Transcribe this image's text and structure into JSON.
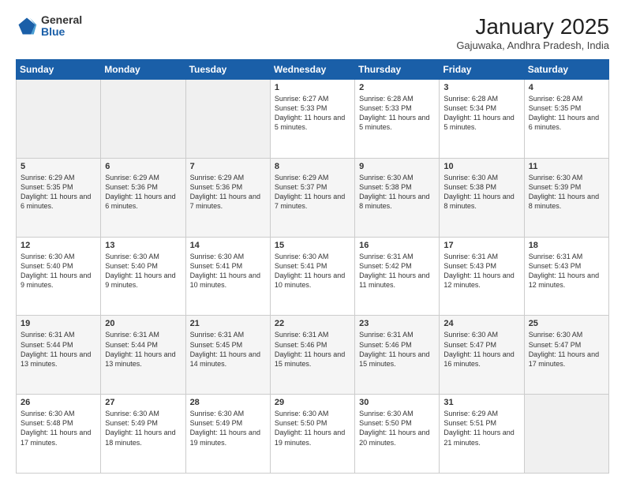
{
  "header": {
    "logo_general": "General",
    "logo_blue": "Blue",
    "month_title": "January 2025",
    "location": "Gajuwaka, Andhra Pradesh, India"
  },
  "weekdays": [
    "Sunday",
    "Monday",
    "Tuesday",
    "Wednesday",
    "Thursday",
    "Friday",
    "Saturday"
  ],
  "weeks": [
    [
      {
        "day": "",
        "sunrise": "",
        "sunset": "",
        "daylight": "",
        "empty": true
      },
      {
        "day": "",
        "sunrise": "",
        "sunset": "",
        "daylight": "",
        "empty": true
      },
      {
        "day": "",
        "sunrise": "",
        "sunset": "",
        "daylight": "",
        "empty": true
      },
      {
        "day": "1",
        "sunrise": "Sunrise: 6:27 AM",
        "sunset": "Sunset: 5:33 PM",
        "daylight": "Daylight: 11 hours and 5 minutes.",
        "empty": false
      },
      {
        "day": "2",
        "sunrise": "Sunrise: 6:28 AM",
        "sunset": "Sunset: 5:33 PM",
        "daylight": "Daylight: 11 hours and 5 minutes.",
        "empty": false
      },
      {
        "day": "3",
        "sunrise": "Sunrise: 6:28 AM",
        "sunset": "Sunset: 5:34 PM",
        "daylight": "Daylight: 11 hours and 5 minutes.",
        "empty": false
      },
      {
        "day": "4",
        "sunrise": "Sunrise: 6:28 AM",
        "sunset": "Sunset: 5:35 PM",
        "daylight": "Daylight: 11 hours and 6 minutes.",
        "empty": false
      }
    ],
    [
      {
        "day": "5",
        "sunrise": "Sunrise: 6:29 AM",
        "sunset": "Sunset: 5:35 PM",
        "daylight": "Daylight: 11 hours and 6 minutes.",
        "empty": false
      },
      {
        "day": "6",
        "sunrise": "Sunrise: 6:29 AM",
        "sunset": "Sunset: 5:36 PM",
        "daylight": "Daylight: 11 hours and 6 minutes.",
        "empty": false
      },
      {
        "day": "7",
        "sunrise": "Sunrise: 6:29 AM",
        "sunset": "Sunset: 5:36 PM",
        "daylight": "Daylight: 11 hours and 7 minutes.",
        "empty": false
      },
      {
        "day": "8",
        "sunrise": "Sunrise: 6:29 AM",
        "sunset": "Sunset: 5:37 PM",
        "daylight": "Daylight: 11 hours and 7 minutes.",
        "empty": false
      },
      {
        "day": "9",
        "sunrise": "Sunrise: 6:30 AM",
        "sunset": "Sunset: 5:38 PM",
        "daylight": "Daylight: 11 hours and 8 minutes.",
        "empty": false
      },
      {
        "day": "10",
        "sunrise": "Sunrise: 6:30 AM",
        "sunset": "Sunset: 5:38 PM",
        "daylight": "Daylight: 11 hours and 8 minutes.",
        "empty": false
      },
      {
        "day": "11",
        "sunrise": "Sunrise: 6:30 AM",
        "sunset": "Sunset: 5:39 PM",
        "daylight": "Daylight: 11 hours and 8 minutes.",
        "empty": false
      }
    ],
    [
      {
        "day": "12",
        "sunrise": "Sunrise: 6:30 AM",
        "sunset": "Sunset: 5:40 PM",
        "daylight": "Daylight: 11 hours and 9 minutes.",
        "empty": false
      },
      {
        "day": "13",
        "sunrise": "Sunrise: 6:30 AM",
        "sunset": "Sunset: 5:40 PM",
        "daylight": "Daylight: 11 hours and 9 minutes.",
        "empty": false
      },
      {
        "day": "14",
        "sunrise": "Sunrise: 6:30 AM",
        "sunset": "Sunset: 5:41 PM",
        "daylight": "Daylight: 11 hours and 10 minutes.",
        "empty": false
      },
      {
        "day": "15",
        "sunrise": "Sunrise: 6:30 AM",
        "sunset": "Sunset: 5:41 PM",
        "daylight": "Daylight: 11 hours and 10 minutes.",
        "empty": false
      },
      {
        "day": "16",
        "sunrise": "Sunrise: 6:31 AM",
        "sunset": "Sunset: 5:42 PM",
        "daylight": "Daylight: 11 hours and 11 minutes.",
        "empty": false
      },
      {
        "day": "17",
        "sunrise": "Sunrise: 6:31 AM",
        "sunset": "Sunset: 5:43 PM",
        "daylight": "Daylight: 11 hours and 12 minutes.",
        "empty": false
      },
      {
        "day": "18",
        "sunrise": "Sunrise: 6:31 AM",
        "sunset": "Sunset: 5:43 PM",
        "daylight": "Daylight: 11 hours and 12 minutes.",
        "empty": false
      }
    ],
    [
      {
        "day": "19",
        "sunrise": "Sunrise: 6:31 AM",
        "sunset": "Sunset: 5:44 PM",
        "daylight": "Daylight: 11 hours and 13 minutes.",
        "empty": false
      },
      {
        "day": "20",
        "sunrise": "Sunrise: 6:31 AM",
        "sunset": "Sunset: 5:44 PM",
        "daylight": "Daylight: 11 hours and 13 minutes.",
        "empty": false
      },
      {
        "day": "21",
        "sunrise": "Sunrise: 6:31 AM",
        "sunset": "Sunset: 5:45 PM",
        "daylight": "Daylight: 11 hours and 14 minutes.",
        "empty": false
      },
      {
        "day": "22",
        "sunrise": "Sunrise: 6:31 AM",
        "sunset": "Sunset: 5:46 PM",
        "daylight": "Daylight: 11 hours and 15 minutes.",
        "empty": false
      },
      {
        "day": "23",
        "sunrise": "Sunrise: 6:31 AM",
        "sunset": "Sunset: 5:46 PM",
        "daylight": "Daylight: 11 hours and 15 minutes.",
        "empty": false
      },
      {
        "day": "24",
        "sunrise": "Sunrise: 6:30 AM",
        "sunset": "Sunset: 5:47 PM",
        "daylight": "Daylight: 11 hours and 16 minutes.",
        "empty": false
      },
      {
        "day": "25",
        "sunrise": "Sunrise: 6:30 AM",
        "sunset": "Sunset: 5:47 PM",
        "daylight": "Daylight: 11 hours and 17 minutes.",
        "empty": false
      }
    ],
    [
      {
        "day": "26",
        "sunrise": "Sunrise: 6:30 AM",
        "sunset": "Sunset: 5:48 PM",
        "daylight": "Daylight: 11 hours and 17 minutes.",
        "empty": false
      },
      {
        "day": "27",
        "sunrise": "Sunrise: 6:30 AM",
        "sunset": "Sunset: 5:49 PM",
        "daylight": "Daylight: 11 hours and 18 minutes.",
        "empty": false
      },
      {
        "day": "28",
        "sunrise": "Sunrise: 6:30 AM",
        "sunset": "Sunset: 5:49 PM",
        "daylight": "Daylight: 11 hours and 19 minutes.",
        "empty": false
      },
      {
        "day": "29",
        "sunrise": "Sunrise: 6:30 AM",
        "sunset": "Sunset: 5:50 PM",
        "daylight": "Daylight: 11 hours and 19 minutes.",
        "empty": false
      },
      {
        "day": "30",
        "sunrise": "Sunrise: 6:30 AM",
        "sunset": "Sunset: 5:50 PM",
        "daylight": "Daylight: 11 hours and 20 minutes.",
        "empty": false
      },
      {
        "day": "31",
        "sunrise": "Sunrise: 6:29 AM",
        "sunset": "Sunset: 5:51 PM",
        "daylight": "Daylight: 11 hours and 21 minutes.",
        "empty": false
      },
      {
        "day": "",
        "sunrise": "",
        "sunset": "",
        "daylight": "",
        "empty": true
      }
    ]
  ]
}
